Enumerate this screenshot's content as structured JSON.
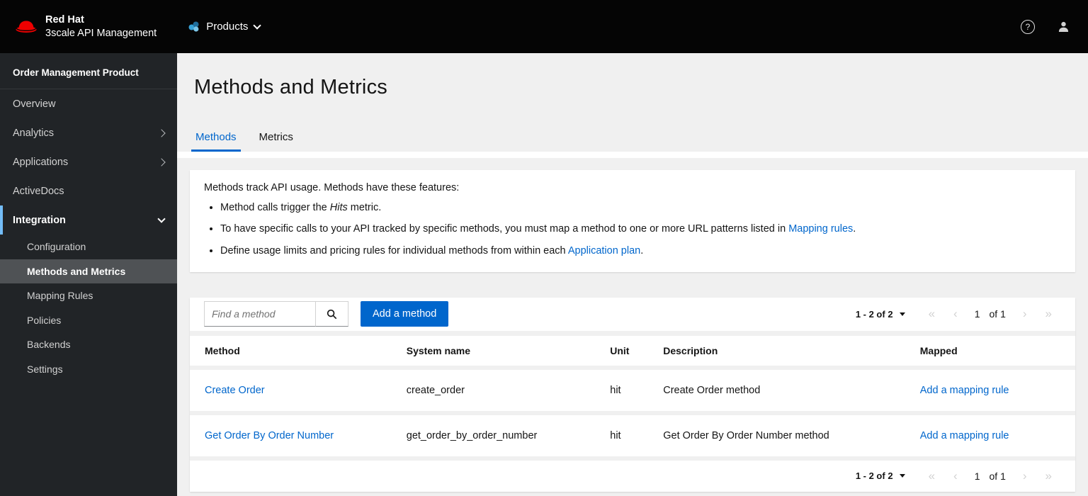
{
  "colors": {
    "accent": "#0066cc",
    "brand_red": "#ee0000",
    "nav_active_border": "#73bcf7",
    "masthead_bg": "#050505",
    "sidebar_bg": "#212427"
  },
  "icons": {
    "nav_first": "«",
    "nav_prev": "‹",
    "nav_next": "›",
    "nav_last": "»"
  },
  "masthead": {
    "brand_line1": "Red Hat",
    "brand_line2": "3scale API Management",
    "products_label": "Products",
    "help_label": "?"
  },
  "sidebar": {
    "context": "Order Management Product",
    "items": [
      {
        "label": "Overview"
      },
      {
        "label": "Analytics"
      },
      {
        "label": "Applications"
      },
      {
        "label": "ActiveDocs"
      },
      {
        "label": "Integration"
      }
    ],
    "sub": [
      "Configuration",
      "Methods and Metrics",
      "Mapping Rules",
      "Policies",
      "Backends",
      "Settings"
    ]
  },
  "main": {
    "title": "Methods and Metrics",
    "tabs": {
      "methods": "Methods",
      "metrics": "Metrics"
    },
    "info": {
      "intro": "Methods track API usage. Methods have these features:",
      "b1_pre": "Method calls trigger the ",
      "b1_em": "Hits",
      "b1_post": " metric.",
      "b2_pre": "To have specific calls to your API tracked by specific methods, you must map a method to one or more URL patterns listed in ",
      "b2_link": "Mapping rules",
      "b2_post": ".",
      "b3_pre": "Define usage limits and pricing rules for individual methods from within each ",
      "b3_link": "Application plan",
      "b3_post": "."
    },
    "toolbar": {
      "search_placeholder": "Find a method",
      "add_button": "Add a method"
    },
    "pagination": {
      "range": "1 - 2 of 2",
      "page": "1",
      "of_pages": "of 1"
    },
    "table": {
      "headers": [
        "Method",
        "System name",
        "Unit",
        "Description",
        "Mapped"
      ],
      "rows": [
        {
          "method": "Create Order",
          "system_name": "create_order",
          "unit": "hit",
          "description": "Create Order method",
          "mapped": "Add a mapping rule"
        },
        {
          "method": "Get Order By Order Number",
          "system_name": "get_order_by_order_number",
          "unit": "hit",
          "description": "Get Order By Order Number method",
          "mapped": "Add a mapping rule"
        }
      ]
    }
  }
}
